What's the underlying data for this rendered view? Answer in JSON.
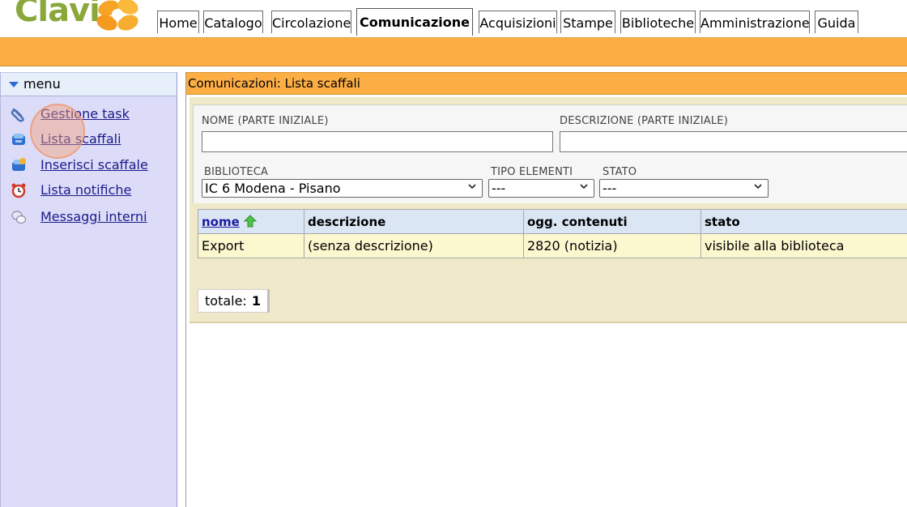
{
  "app": {
    "logo_text": "Clavis"
  },
  "nav": {
    "tabs": [
      {
        "label": "Home"
      },
      {
        "label": "Catalogo"
      },
      {
        "label": "Circolazione"
      },
      {
        "label": "Comunicazione",
        "active": true
      },
      {
        "label": "Acquisizioni"
      },
      {
        "label": "Stampe"
      },
      {
        "label": "Biblioteche"
      },
      {
        "label": "Amministrazione"
      },
      {
        "label": "Guida"
      }
    ]
  },
  "sidebar": {
    "title": "menu",
    "items": [
      {
        "label": "Gestione task",
        "icon": "paperclip-icon"
      },
      {
        "label": "Lista scaffali",
        "icon": "shelf-icon"
      },
      {
        "label": "Inserisci scaffale",
        "icon": "add-shelf-icon"
      },
      {
        "label": "Lista notifiche",
        "icon": "alarm-clock-icon"
      },
      {
        "label": "Messaggi interni",
        "icon": "messages-icon"
      }
    ]
  },
  "page": {
    "title": "Comunicazioni: Lista scaffali"
  },
  "filters": {
    "name_label": "NOME (PARTE INIZIALE)",
    "name_value": "",
    "description_label": "DESCRIZIONE (PARTE INIZIALE)",
    "description_value": "",
    "library_label": "BIBLIOTECA",
    "library_value": "IC 6 Modena - Pisano",
    "element_type_label": "TIPO ELEMENTI",
    "element_type_value": "---",
    "status_label": "STATO",
    "status_value": "---"
  },
  "table": {
    "columns": [
      "nome",
      "descrizione",
      "ogg. contenuti",
      "stato"
    ],
    "sort_column": "nome",
    "sort_direction": "ascending",
    "rows": [
      [
        "Export",
        "(senza descrizione)",
        "2820 (notizia)",
        "visibile alla biblioteca"
      ]
    ]
  },
  "summary": {
    "total_label": "totale:",
    "total_value": "1"
  },
  "colors": {
    "accent_orange": "#fcae45",
    "sidebar_bg": "#dcdcf8",
    "panel_bg": "#efe9c9",
    "row_bg": "#fbf7cf",
    "header_bg": "#dbe6f5",
    "link": "#1a1a8a"
  }
}
